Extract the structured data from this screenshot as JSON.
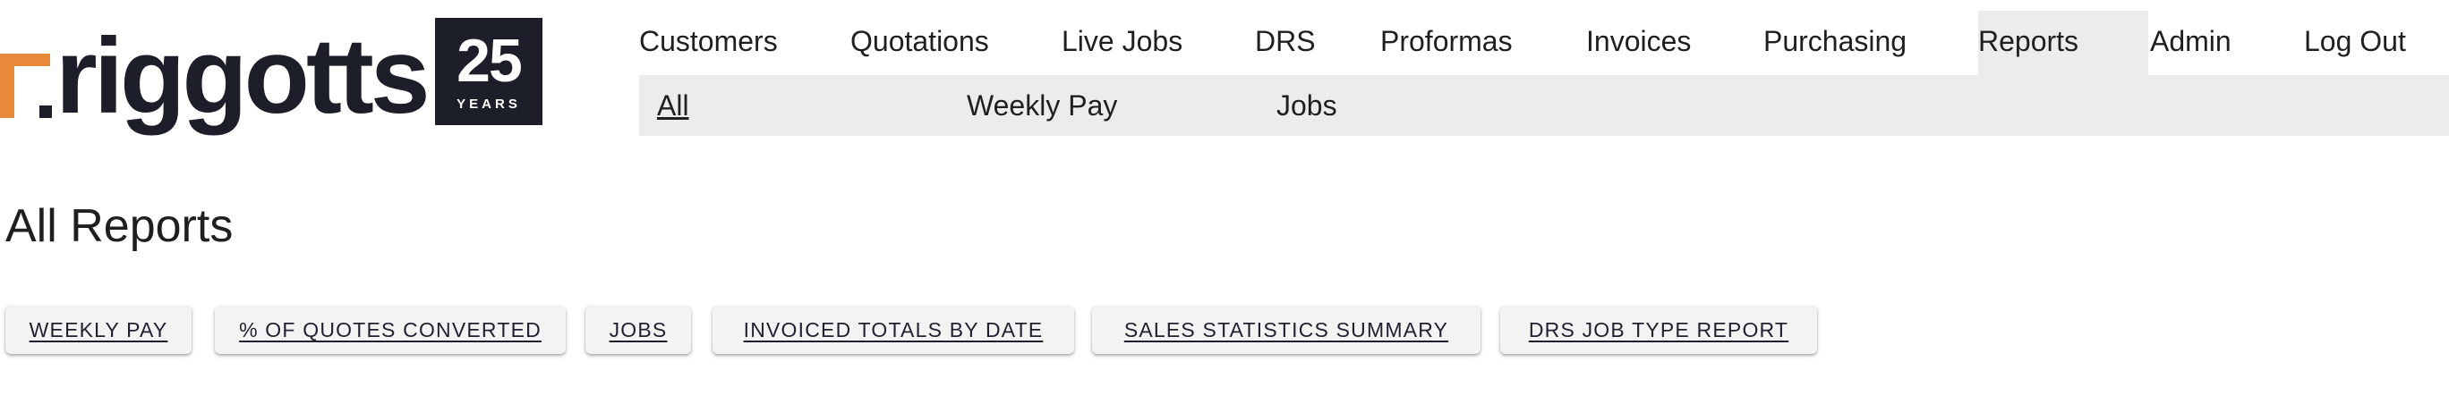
{
  "logo": {
    "wordmark": "riggotts",
    "badge_number": "25",
    "badge_label": "YEARS"
  },
  "main_nav": [
    "Customers",
    "Quotations",
    "Live Jobs",
    "DRS",
    "Proformas",
    "Invoices",
    "Purchasing",
    "Reports",
    "Admin",
    "Log Out"
  ],
  "active_nav": "Reports",
  "sub_nav": [
    "All",
    "Weekly Pay",
    "Jobs"
  ],
  "active_sub": "All",
  "page_title": "All Reports",
  "report_buttons": [
    "WEEKLY PAY",
    "% OF QUOTES CONVERTED",
    "JOBS",
    "INVOICED TOTALS BY DATE",
    "SALES STATISTICS SUMMARY",
    "DRS JOB TYPE REPORT"
  ],
  "colors": {
    "brand_orange": "#e8893a",
    "brand_dark": "#1c1f2a",
    "nav_active_bg": "#ececec"
  }
}
